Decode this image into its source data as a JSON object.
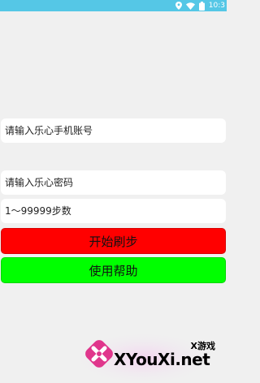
{
  "status_bar": {
    "time": "10:3",
    "bg_color": "#55c7e6",
    "icons": [
      "location-icon",
      "wifi-icon",
      "battery-icon"
    ]
  },
  "form": {
    "phone_placeholder": "请输入乐心手机账号",
    "password_placeholder": "请输入乐心密码",
    "steps_placeholder": "1～99999步数"
  },
  "buttons": {
    "start_label": "开始刷步",
    "start_color": "#ff0000",
    "help_label": "使用帮助",
    "help_color": "#00ff00"
  },
  "watermark": {
    "brand_cn": "X游戏",
    "brand_en": "XYouXi.net",
    "logo_icon": "gamepad-x-logo-icon"
  }
}
